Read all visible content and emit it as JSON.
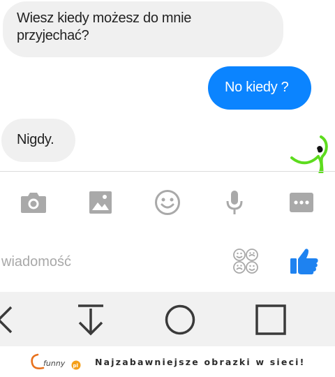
{
  "messages": [
    {
      "direction": "incoming",
      "text": "Wiesz kiedy możesz do mnie\nprzyjechać?"
    },
    {
      "direction": "outgoing",
      "text": "No kiedy ?"
    },
    {
      "direction": "incoming",
      "text": "Nigdy."
    }
  ],
  "composer": {
    "toolbar": [
      "camera-icon",
      "image-icon",
      "emoji-icon",
      "microphone-icon",
      "more-icon"
    ],
    "input_placeholder": "wiadomość",
    "sticker_icon": "stickers-icon",
    "send_icon": "thumbs-up-icon"
  },
  "navbar": [
    "back-icon",
    "download-icon",
    "home-icon",
    "recents-icon"
  ],
  "watermark": {
    "logo_text": "funny",
    "logo_suffix": "pl",
    "tagline": "Najzabawniejsze obrazki w sieci!"
  },
  "colors": {
    "incoming_bubble": "#f0f0f0",
    "outgoing_bubble": "#0b84ff",
    "icon_gray": "#a9a9a9",
    "like_blue": "#1e82f0",
    "doodle_green": "#5ddc1e",
    "navbar_bg": "#f1f1f1"
  }
}
